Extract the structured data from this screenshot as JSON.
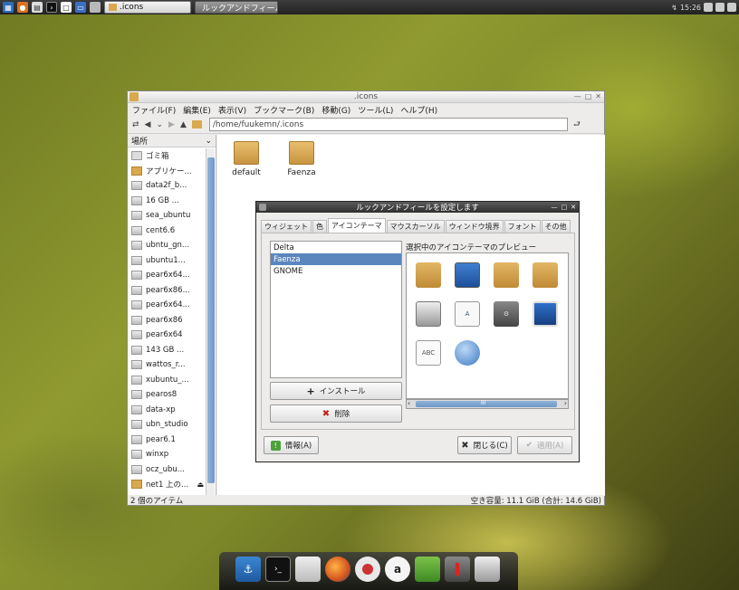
{
  "top_panel": {
    "tasks": [
      {
        "label": ".icons",
        "active": false
      },
      {
        "label": "ルックアンドフィール...",
        "active": true
      }
    ],
    "clock": "15:26"
  },
  "file_manager": {
    "title": ".icons",
    "menu": [
      "ファイル(F)",
      "編集(E)",
      "表示(V)",
      "ブックマーク(B)",
      "移動(G)",
      "ツール(L)",
      "ヘルプ(H)"
    ],
    "path": "/home/fuukemn/.icons",
    "sidebar_header": "場所",
    "places": [
      {
        "label": "ゴミ箱",
        "kind": "trash"
      },
      {
        "label": "アプリケー...",
        "kind": "folder"
      },
      {
        "label": "data2f_b...",
        "kind": "drive"
      },
      {
        "label": "16 GB ...",
        "kind": "drive"
      },
      {
        "label": "sea_ubuntu",
        "kind": "drive"
      },
      {
        "label": "cent6.6",
        "kind": "drive"
      },
      {
        "label": "ubntu_gn...",
        "kind": "drive"
      },
      {
        "label": "ubuntu1...",
        "kind": "drive"
      },
      {
        "label": "pear6x64...",
        "kind": "drive"
      },
      {
        "label": "pear6x86...",
        "kind": "drive"
      },
      {
        "label": "pear6x64...",
        "kind": "drive"
      },
      {
        "label": "pear6x86",
        "kind": "drive"
      },
      {
        "label": "pear6x64",
        "kind": "drive"
      },
      {
        "label": "143 GB ...",
        "kind": "drive"
      },
      {
        "label": "wattos_r...",
        "kind": "drive"
      },
      {
        "label": "xubuntu_...",
        "kind": "drive"
      },
      {
        "label": "pearos8",
        "kind": "drive"
      },
      {
        "label": "data-xp",
        "kind": "drive"
      },
      {
        "label": "ubn_studio",
        "kind": "drive"
      },
      {
        "label": "pear6.1",
        "kind": "drive"
      },
      {
        "label": "winxp",
        "kind": "drive"
      },
      {
        "label": "ocz_ubu...",
        "kind": "drive"
      },
      {
        "label": "net1 上の...",
        "kind": "folder"
      }
    ],
    "files": [
      {
        "label": "default"
      },
      {
        "label": "Faenza"
      }
    ],
    "status_left": "2 個のアイテム",
    "status_right": "空き容量: 11.1 GiB (合計: 14.6 GiB)"
  },
  "dialog": {
    "title": "ルックアンドフィールを設定します",
    "tabs": [
      "ウィジェット",
      "色",
      "アイコンテーマ",
      "マウスカーソル",
      "ウィンドウ境界",
      "フォント",
      "その他"
    ],
    "active_tab": "アイコンテーマ",
    "themes": [
      "Delta",
      "Faenza",
      "GNOME"
    ],
    "selected_theme": "Faenza",
    "install_label": "インストール",
    "delete_label": "削除",
    "preview_label": "選択中のアイコンテーマのプレビュー",
    "preview_icons": [
      "folder-icon",
      "desktop-icon",
      "folder-icon",
      "network-folder-icon",
      "trash-icon",
      "text-document-icon",
      "settings-icon",
      "screen-icon",
      "spellcheck-icon",
      "globe-icon"
    ],
    "abc_text": "ABC",
    "info_label": "情報(A)",
    "close_label": "閉じる(C)",
    "apply_label": "適用(A)",
    "hscroll_mark": "III"
  },
  "dock": {
    "icons": [
      "anchor-icon",
      "terminal-icon",
      "files-icon",
      "firefox-icon",
      "disc-icon",
      "amazon-icon",
      "notebook-icon",
      "user-icon",
      "trash-icon"
    ]
  }
}
